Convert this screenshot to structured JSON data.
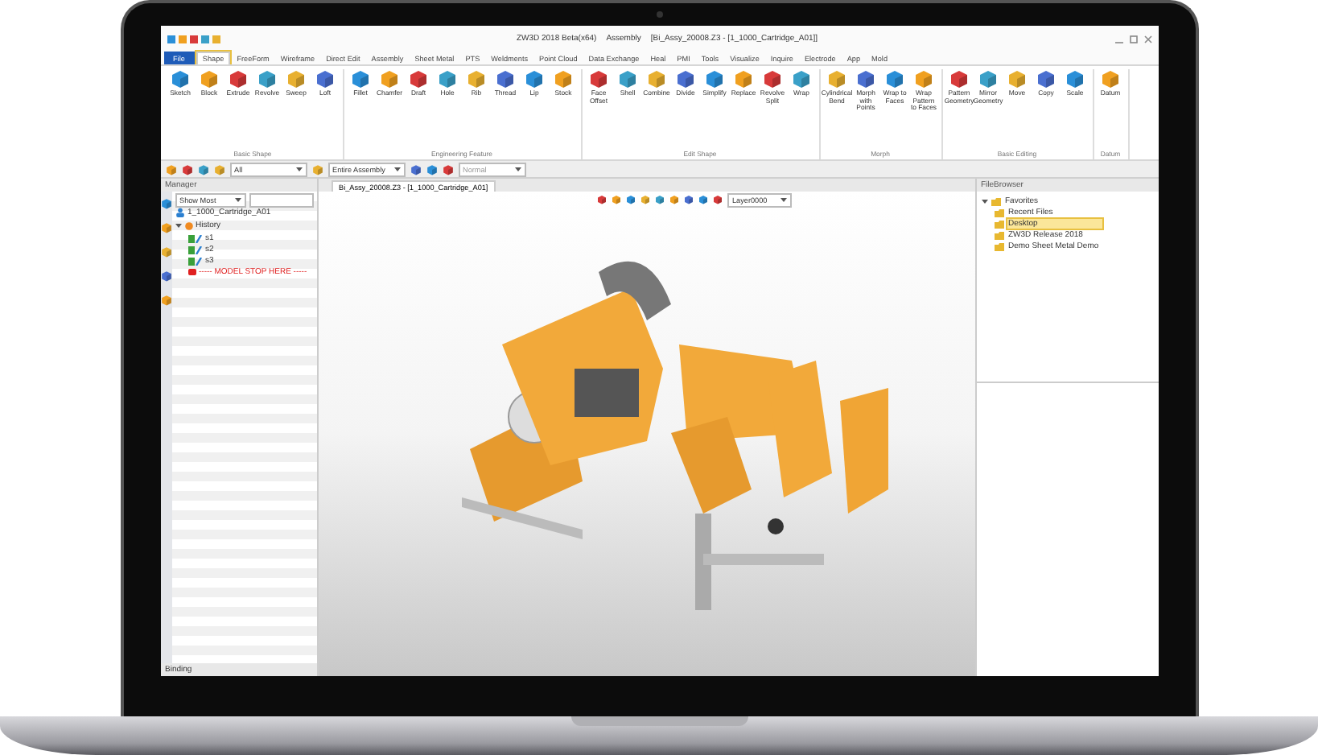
{
  "window": {
    "title": "ZW3D 2018 Beta(x64)",
    "mode": "Assembly",
    "document": "[Bi_Assy_20008.Z3 - [1_1000_Cartridge_A01]]"
  },
  "menu_tabs": [
    {
      "label": "File",
      "kind": "file",
      "selected": false
    },
    {
      "label": "Shape",
      "kind": "tab",
      "selected": true
    },
    {
      "label": "FreeForm",
      "kind": "tab",
      "selected": false
    },
    {
      "label": "Wireframe",
      "kind": "tab",
      "selected": false
    },
    {
      "label": "Direct Edit",
      "kind": "tab",
      "selected": false
    },
    {
      "label": "Assembly",
      "kind": "tab",
      "selected": false
    },
    {
      "label": "Sheet Metal",
      "kind": "tab",
      "selected": false
    },
    {
      "label": "PTS",
      "kind": "tab",
      "selected": false
    },
    {
      "label": "Weldments",
      "kind": "tab",
      "selected": false
    },
    {
      "label": "Point Cloud",
      "kind": "tab",
      "selected": false
    },
    {
      "label": "Data Exchange",
      "kind": "tab",
      "selected": false
    },
    {
      "label": "Heal",
      "kind": "tab",
      "selected": false
    },
    {
      "label": "PMI",
      "kind": "tab",
      "selected": false
    },
    {
      "label": "Tools",
      "kind": "tab",
      "selected": false
    },
    {
      "label": "Visualize",
      "kind": "tab",
      "selected": false
    },
    {
      "label": "Inquire",
      "kind": "tab",
      "selected": false
    },
    {
      "label": "Electrode",
      "kind": "tab",
      "selected": false
    },
    {
      "label": "App",
      "kind": "tab",
      "selected": false
    },
    {
      "label": "Mold",
      "kind": "tab",
      "selected": false
    }
  ],
  "ribbon": [
    {
      "group": "Basic Shape",
      "tools": [
        "Sketch",
        "Block",
        "Extrude",
        "Revolve",
        "Sweep",
        "Loft"
      ]
    },
    {
      "group": "Engineering Feature",
      "tools": [
        "Fillet",
        "Chamfer",
        "Draft",
        "Hole",
        "Rib",
        "Thread",
        "Lip",
        "Stock"
      ]
    },
    {
      "group": "Edit Shape",
      "tools": [
        "Face Offset",
        "Shell",
        "Combine",
        "Divide",
        "Simplify",
        "Replace",
        "Revolve Split",
        "Wrap"
      ]
    },
    {
      "group": "Morph",
      "tools": [
        "Cylindrical Bend",
        "Morph with Points",
        "Wrap to Faces",
        "Wrap Pattern to Faces"
      ]
    },
    {
      "group": "Basic Editing",
      "tools": [
        "Pattern Geometry",
        "Mirror Geometry",
        "Move",
        "Copy",
        "Scale"
      ]
    },
    {
      "group": "Datum",
      "tools": [
        "Datum"
      ]
    }
  ],
  "toolbar": {
    "filter": "All",
    "scope": "Entire Assembly",
    "view": "Normal"
  },
  "manager": {
    "title": "Manager",
    "filter": "Show Most",
    "footer": "Binding",
    "tree": [
      {
        "label": "1_1000_Cartridge_A01",
        "kind": "part"
      },
      {
        "label": "History",
        "kind": "history",
        "expanded": true,
        "children": [
          {
            "label": "s1",
            "kind": "feature"
          },
          {
            "label": "s2",
            "kind": "feature"
          },
          {
            "label": "s3",
            "kind": "feature"
          },
          {
            "label": "----- MODEL STOP HERE -----",
            "kind": "stop"
          }
        ]
      }
    ]
  },
  "document_tab": {
    "label": "Bi_Assy_20008.Z3 - [1_1000_Cartridge_A01]"
  },
  "viewport": {
    "layer": "Layer0000"
  },
  "file_browser": {
    "title": "FileBrowser",
    "tree": [
      {
        "label": "Favorites",
        "expanded": true,
        "selected": false,
        "children": [
          {
            "label": "Recent Files",
            "selected": false
          },
          {
            "label": "Desktop",
            "selected": true
          },
          {
            "label": "ZW3D Release 2018",
            "selected": false
          },
          {
            "label": "Demo Sheet Metal Demo",
            "selected": false
          }
        ]
      }
    ]
  }
}
